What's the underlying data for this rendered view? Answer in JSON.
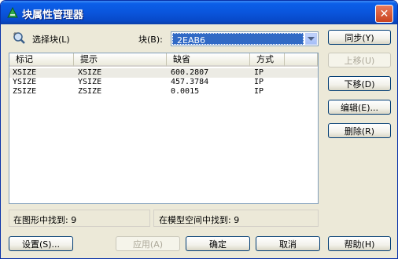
{
  "window": {
    "title": "块属性管理器",
    "close_glyph": "✕"
  },
  "select_block": {
    "label": "选择块(L)"
  },
  "block_field": {
    "label": "块(B):",
    "value": "2EAB6"
  },
  "list": {
    "columns": [
      "标记",
      "提示",
      "缺省",
      "方式"
    ],
    "rows": [
      [
        "XSIZE",
        "XSIZE",
        "600.2807",
        "IP"
      ],
      [
        "YSIZE",
        "YSIZE",
        "457.3784",
        "IP"
      ],
      [
        "ZSIZE",
        "ZSIZE",
        "0.0015",
        "IP"
      ]
    ]
  },
  "side_buttons": {
    "sync": "同步(Y)",
    "move_up": "上移(U)",
    "move_down": "下移(D)",
    "edit": "编辑(E)...",
    "delete": "删除(R)"
  },
  "status": {
    "found_in_drawing": "在图形中找到: 9",
    "found_in_model_space": "在模型空间中找到: 9"
  },
  "bottom_buttons": {
    "settings": "设置(S)...",
    "apply": "应用(A)",
    "ok": "确定",
    "cancel": "取消",
    "help": "帮助(H)"
  }
}
